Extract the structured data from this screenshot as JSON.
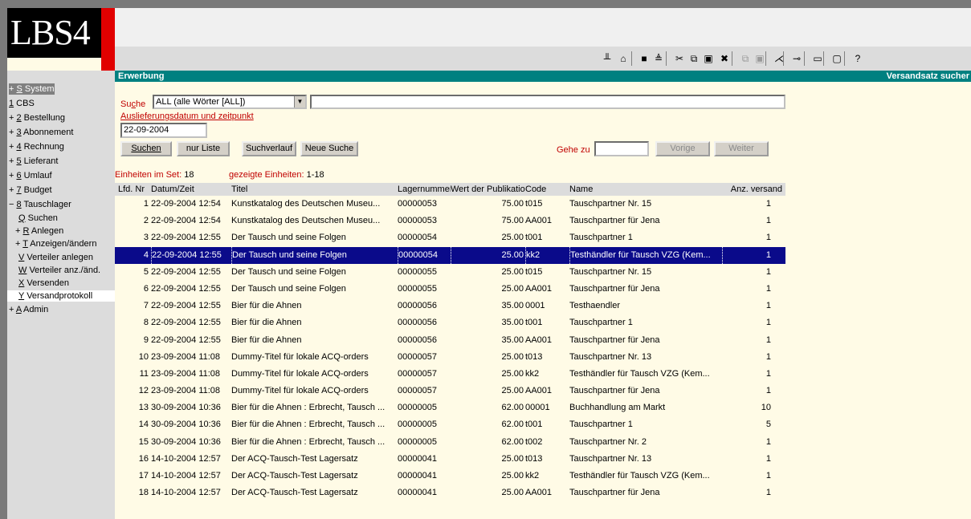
{
  "app": {
    "logo": "LBS4"
  },
  "toolbar": {
    "icons": [
      {
        "name": "scissors-pin-icon",
        "glyph": "╨"
      },
      {
        "name": "home-icon",
        "glyph": "⌂"
      },
      {
        "name": "save-icon",
        "glyph": "■"
      },
      {
        "name": "print-icon",
        "glyph": "≜"
      },
      {
        "name": "cut-icon",
        "glyph": "✂"
      },
      {
        "name": "copy-icon",
        "glyph": "⧉"
      },
      {
        "name": "paste-icon",
        "glyph": "▣"
      },
      {
        "name": "delete-icon",
        "glyph": "✖"
      },
      {
        "name": "copy-disabled-icon",
        "glyph": "⧉"
      },
      {
        "name": "paste-disabled-icon",
        "glyph": "▣"
      },
      {
        "name": "tools-icon",
        "glyph": "⋌"
      },
      {
        "name": "tag-icon",
        "glyph": "⊸"
      },
      {
        "name": "minimize-icon",
        "glyph": "▭"
      },
      {
        "name": "window-icon",
        "glyph": "▢"
      },
      {
        "name": "help-icon",
        "glyph": "?"
      }
    ]
  },
  "header": {
    "title": "Erwerbung",
    "right": "Versandsatz sucher"
  },
  "sidebar": {
    "items": [
      {
        "prefix": "+ ",
        "key": "S",
        "label": " System"
      },
      {
        "prefix": "",
        "key": "1",
        "label": " CBS"
      },
      {
        "prefix": "+ ",
        "key": "2",
        "label": " Bestellung"
      },
      {
        "prefix": "+ ",
        "key": "3",
        "label": " Abonnement"
      },
      {
        "prefix": "+ ",
        "key": "4",
        "label": " Rechnung"
      },
      {
        "prefix": "+ ",
        "key": "5",
        "label": " Lieferant"
      },
      {
        "prefix": "+ ",
        "key": "6",
        "label": " Umlauf"
      },
      {
        "prefix": "+ ",
        "key": "7",
        "label": " Budget"
      },
      {
        "prefix": "− ",
        "key": "8",
        "label": " Tauschlager"
      },
      {
        "prefix": "",
        "key": "Q",
        "label": " Suchen"
      },
      {
        "prefix": "+ ",
        "key": "R",
        "label": " Anlegen"
      },
      {
        "prefix": "+ ",
        "key": "T",
        "label": " Anzeigen/ändern"
      },
      {
        "prefix": "",
        "key": "V",
        "label": " Verteiler anlegen"
      },
      {
        "prefix": "",
        "key": "W",
        "label": " Verteiler anz./änd."
      },
      {
        "prefix": "",
        "key": "X",
        "label": " Versenden"
      },
      {
        "prefix": "",
        "key": "Y",
        "label": " Versandprotokoll"
      },
      {
        "prefix": "+ ",
        "key": "A",
        "label": " Admin"
      }
    ]
  },
  "search": {
    "label_prefix": "Su",
    "label_key": "c",
    "label_suffix": "he",
    "select_value": "ALL (alle Wörter [ALL])",
    "input_value": "",
    "date_label": "Auslieferungsdatum und zeitpunkt",
    "date_value": "22-09-2004"
  },
  "buttons": {
    "suchen": "Suchen",
    "nur_liste": "nur Liste",
    "suchverlauf": "Suchverlauf",
    "neue_suche": "Neue Suche",
    "goto_label": "Gehe zu",
    "vorige": "Vorige",
    "weiter": "Weiter"
  },
  "counts": {
    "set_label": "Einheiten im Set: ",
    "set_value": "18",
    "shown_label": "gezeigte Einheiten: ",
    "shown_value": "1-18"
  },
  "table": {
    "headers": [
      "Lfd. Nr",
      "Datum/Zeit",
      "Titel",
      "Lagernummer",
      "Wert der Publikation",
      "Code",
      "Name",
      "Anz. versand"
    ],
    "selected_index": 3,
    "rows": [
      [
        "1",
        "22-09-2004 12:54",
        "Kunstkatalog des Deutschen Museu...",
        "00000053",
        "75.00",
        "t015",
        "Tauschpartner Nr. 15",
        "1"
      ],
      [
        "2",
        "22-09-2004 12:54",
        "Kunstkatalog des Deutschen Museu...",
        "00000053",
        "75.00",
        "AA001",
        "Tauschpartner für Jena",
        "1"
      ],
      [
        "3",
        "22-09-2004 12:55",
        "Der Tausch und seine Folgen",
        "00000054",
        "25.00",
        "t001",
        "Tauschpartner 1",
        "1"
      ],
      [
        "4",
        "22-09-2004 12:55",
        "Der Tausch und seine Folgen",
        "00000054",
        "25.00",
        "kk2",
        "Testhändler für Tausch VZG (Kem...",
        "1"
      ],
      [
        "5",
        "22-09-2004 12:55",
        "Der Tausch und seine Folgen",
        "00000055",
        "25.00",
        "t015",
        "Tauschpartner Nr. 15",
        "1"
      ],
      [
        "6",
        "22-09-2004 12:55",
        "Der Tausch und seine Folgen",
        "00000055",
        "25.00",
        "AA001",
        "Tauschpartner für Jena",
        "1"
      ],
      [
        "7",
        "22-09-2004 12:55",
        "Bier für die Ahnen",
        "00000056",
        "35.00",
        "0001",
        "Testhaendler",
        "1"
      ],
      [
        "8",
        "22-09-2004 12:55",
        "Bier für die Ahnen",
        "00000056",
        "35.00",
        "t001",
        "Tauschpartner 1",
        "1"
      ],
      [
        "9",
        "22-09-2004 12:55",
        "Bier für die Ahnen",
        "00000056",
        "35.00",
        "AA001",
        "Tauschpartner für Jena",
        "1"
      ],
      [
        "10",
        "23-09-2004 11:08",
        "Dummy-Titel für lokale ACQ-orders",
        "00000057",
        "25.00",
        "t013",
        "Tauschpartner Nr. 13",
        "1"
      ],
      [
        "11",
        "23-09-2004 11:08",
        "Dummy-Titel für lokale ACQ-orders",
        "00000057",
        "25.00",
        "kk2",
        "Testhändler für Tausch VZG (Kem...",
        "1"
      ],
      [
        "12",
        "23-09-2004 11:08",
        "Dummy-Titel für lokale ACQ-orders",
        "00000057",
        "25.00",
        "AA001",
        "Tauschpartner für Jena",
        "1"
      ],
      [
        "13",
        "30-09-2004 10:36",
        "Bier für die Ahnen : Erbrecht, Tausch ...",
        "00000005",
        "62.00",
        "00001",
        "Buchhandlung am Markt",
        "10"
      ],
      [
        "14",
        "30-09-2004 10:36",
        "Bier für die Ahnen : Erbrecht, Tausch ...",
        "00000005",
        "62.00",
        "t001",
        "Tauschpartner 1",
        "5"
      ],
      [
        "15",
        "30-09-2004 10:36",
        "Bier für die Ahnen : Erbrecht, Tausch ...",
        "00000005",
        "62.00",
        "t002",
        "Tauschpartner Nr. 2",
        "1"
      ],
      [
        "16",
        "14-10-2004 12:57",
        "Der ACQ-Tausch-Test Lagersatz",
        "00000041",
        "25.00",
        "t013",
        "Tauschpartner Nr. 13",
        "1"
      ],
      [
        "17",
        "14-10-2004 12:57",
        "Der ACQ-Tausch-Test Lagersatz",
        "00000041",
        "25.00",
        "kk2",
        "Testhändler für Tausch VZG (Kem...",
        "1"
      ],
      [
        "18",
        "14-10-2004 12:57",
        "Der ACQ-Tausch-Test Lagersatz",
        "00000041",
        "25.00",
        "AA001",
        "Tauschpartner für Jena",
        "1"
      ]
    ]
  },
  "colors": {
    "header_teal": "#008080",
    "label_red": "#c00000",
    "selection_blue": "#0a0a8a",
    "background": "#fffbe6"
  }
}
